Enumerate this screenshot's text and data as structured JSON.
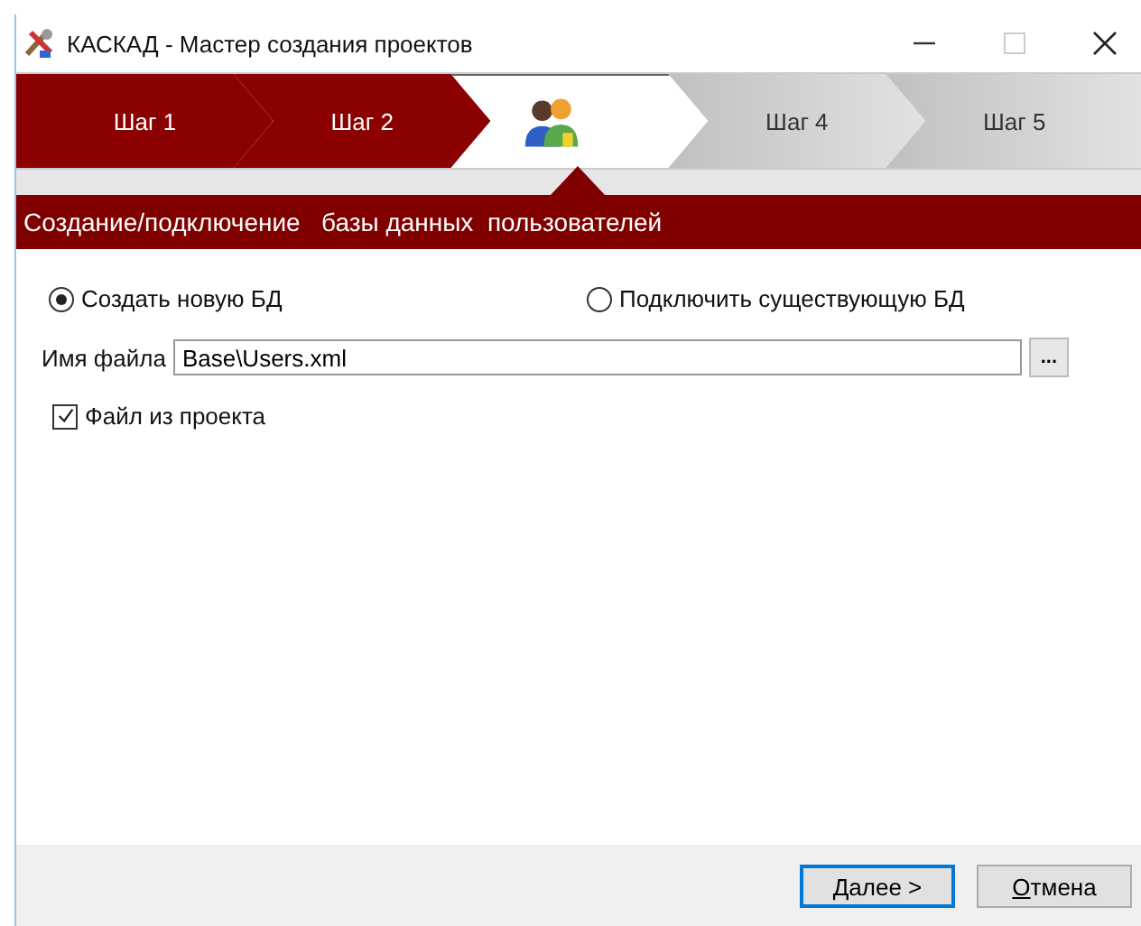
{
  "window": {
    "title": "КАСКАД - Мастер создания проектов"
  },
  "steps": [
    {
      "label": "Шаг 1",
      "completed": true,
      "selected": false
    },
    {
      "label": "Шаг 2",
      "completed": true,
      "selected": false
    },
    {
      "kind": "icon",
      "selected": true
    },
    {
      "label": "Шаг 4",
      "completed": false,
      "selected": false
    },
    {
      "label": "Шаг 5",
      "completed": false,
      "selected": false
    }
  ],
  "subtitle": "Создание/подключение   базы данных  пользователей",
  "db_mode": [
    {
      "label": "Создать новую БД",
      "selected": true
    },
    {
      "label": "Подключить существующую БД",
      "selected": false
    }
  ],
  "file_field": {
    "label": "Имя файла",
    "value": "Base\\Users.xml",
    "browse": "..."
  },
  "from_project": {
    "label": "Файл из проекта",
    "checked": true
  },
  "buttons": [
    {
      "mnemonic": "Д",
      "rest": "алее >",
      "default": true
    },
    {
      "mnemonic": "О",
      "rest": "тмена",
      "default": false
    }
  ]
}
